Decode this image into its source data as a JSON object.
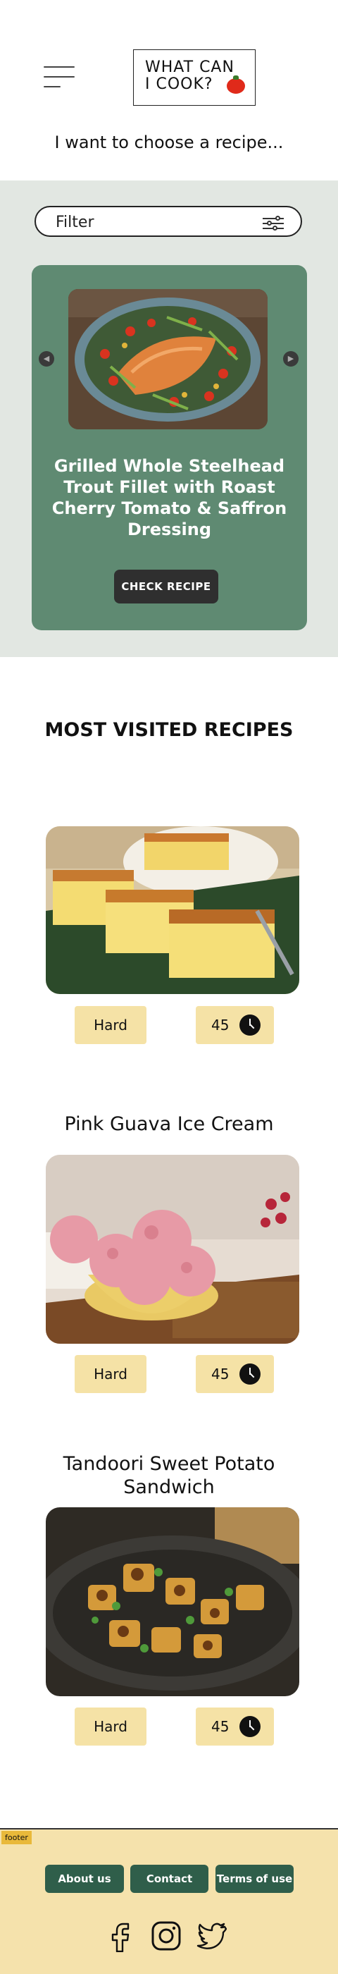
{
  "header": {
    "logo_line1": "WHAT CAN",
    "logo_line2": "I COOK?",
    "menu_icon": "hamburger-menu-icon"
  },
  "intro": {
    "text": "I want to choose a recipe..."
  },
  "chooser": {
    "filter_label": "Filter",
    "filter_icon": "sliders-icon",
    "featured": {
      "title": "Grilled Whole Steelhead Trout Fillet with Roast Cherry Tomato & Saffron Dressing",
      "button": "CHECK RECIPE",
      "prev_icon": "chevron-left-icon",
      "next_icon": "chevron-right-icon"
    }
  },
  "most_visited": {
    "heading": "MOST VISITED RECIPES",
    "recipes": [
      {
        "title": "",
        "difficulty": "Hard",
        "time": "45"
      },
      {
        "title": "Pink Guava Ice Cream",
        "difficulty": "Hard",
        "time": "45"
      },
      {
        "title": "Tandoori Sweet Potato Sandwich",
        "difficulty": "Hard",
        "time": "45"
      }
    ]
  },
  "footer": {
    "tag": "footer",
    "about": "About us",
    "contact": "Contact",
    "terms": "Terms of use",
    "social_icons": [
      "facebook-icon",
      "instagram-icon",
      "twitter-icon"
    ]
  },
  "colors": {
    "card_green": "#5f8a72",
    "section_bg": "#e2e7e2",
    "badge_yellow": "#f5e2a6",
    "footer_bg": "#f5e2ac",
    "footer_button": "#2f5e4a"
  }
}
